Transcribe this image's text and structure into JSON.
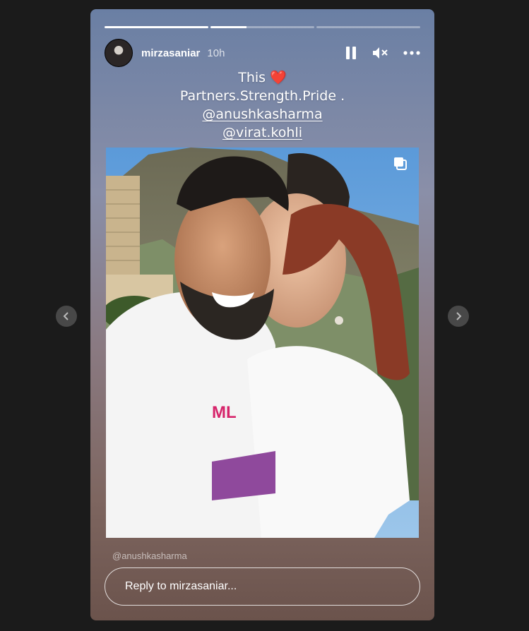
{
  "story": {
    "progress": [
      1.0,
      0.35,
      0.0
    ],
    "user": {
      "username": "mirzasaniar",
      "time": "10h"
    },
    "controls": {
      "pause": "pause-icon",
      "mute": "muted-speaker-icon",
      "more": "more-options-icon"
    },
    "caption": {
      "line1": "This ❤️",
      "line2": "Partners.Strength.Pride .",
      "mention1": "@anushkasharma",
      "mention2": "@virat.kohli"
    },
    "photo_credit": "@anushkasharma",
    "reply": {
      "placeholder": "Reply to mirzasaniar..."
    }
  },
  "nav": {
    "prev": "chevron-left-icon",
    "next": "chevron-right-icon"
  }
}
